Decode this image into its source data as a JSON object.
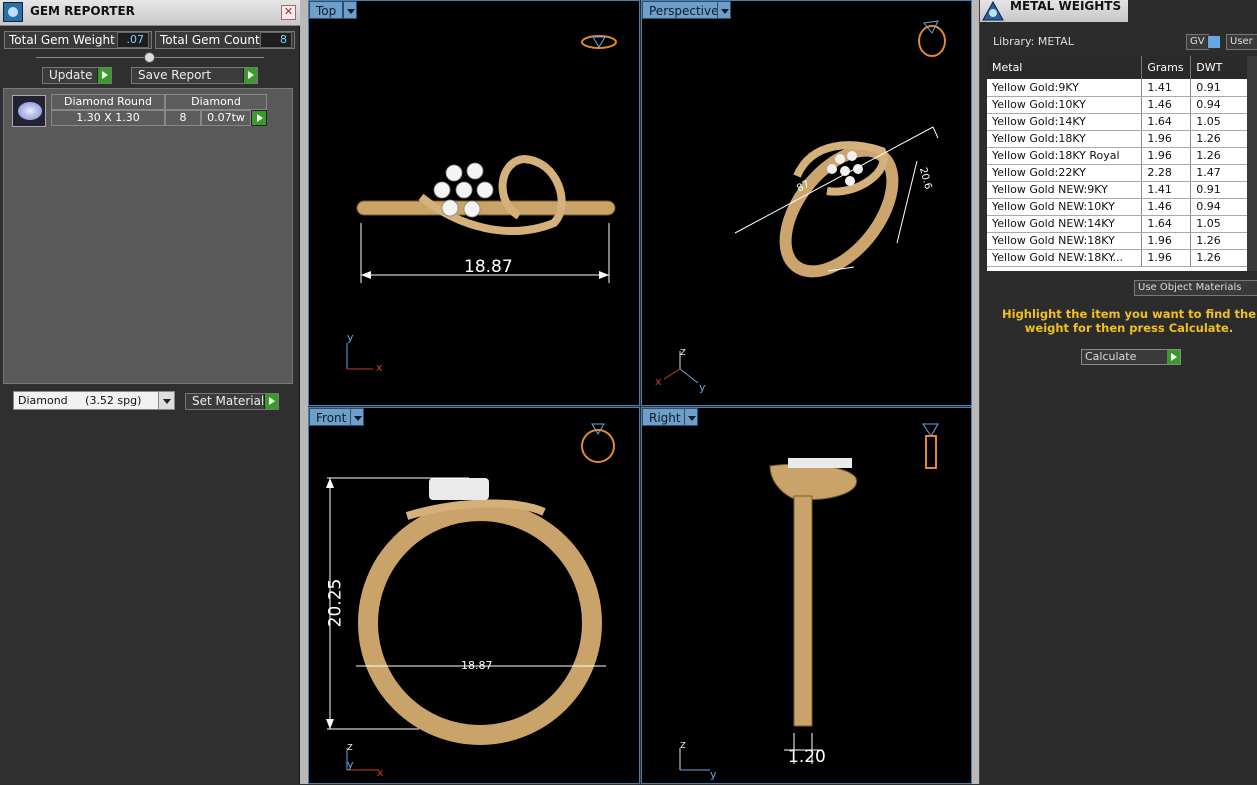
{
  "gem_reporter": {
    "title": "GEM REPORTER",
    "close": "✕",
    "total_weight_label": "Total Gem Weight",
    "total_weight_value": ".07",
    "total_count_label": "Total Gem Count",
    "total_count_value": "8",
    "update_label": "Update",
    "save_report_label": "Save Report",
    "gem_row": {
      "shape": "Diamond Round",
      "size": "1.30 X 1.30",
      "material": "Diamond",
      "count": "8",
      "weight": "0.07tw"
    },
    "material_select": "Diamond     (3.52 spg)",
    "set_material_label": "Set Material"
  },
  "viewports": {
    "top": {
      "label": "Top",
      "dimension": "18.87"
    },
    "perspective": {
      "label": "Perspective",
      "dim_a": "87",
      "dim_b": "20.6"
    },
    "front": {
      "label": "Front",
      "dim_height": "20.25",
      "dim_width": "18.87"
    },
    "right": {
      "label": "Right",
      "dimension": "1.20"
    }
  },
  "axes": {
    "x": "x",
    "y": "y",
    "z": "z"
  },
  "metal_weights": {
    "title": "METAL WEIGHTS",
    "library": "Library: METAL",
    "gv_label": "GV",
    "user_label": "User",
    "columns": [
      "Metal",
      "Grams",
      "DWT"
    ],
    "rows": [
      [
        "Yellow Gold:9KY",
        "1.41",
        "0.91"
      ],
      [
        "Yellow Gold:10KY",
        "1.46",
        "0.94"
      ],
      [
        "Yellow Gold:14KY",
        "1.64",
        "1.05"
      ],
      [
        "Yellow Gold:18KY",
        "1.96",
        "1.26"
      ],
      [
        "Yellow Gold:18KY Royal",
        "1.96",
        "1.26"
      ],
      [
        "Yellow Gold:22KY",
        "2.28",
        "1.47"
      ],
      [
        "Yellow Gold NEW:9KY",
        "1.41",
        "0.91"
      ],
      [
        "Yellow Gold NEW:10KY",
        "1.46",
        "0.94"
      ],
      [
        "Yellow Gold NEW:14KY",
        "1.64",
        "1.05"
      ],
      [
        "Yellow Gold NEW:18KY",
        "1.96",
        "1.26"
      ],
      [
        "Yellow Gold NEW:18KY...",
        "1.96",
        "1.26"
      ]
    ],
    "use_object_materials": "Use Object Materials",
    "hint": "Highlight the item you want to find the weight for then press Calculate.",
    "calculate_label": "Calculate"
  }
}
